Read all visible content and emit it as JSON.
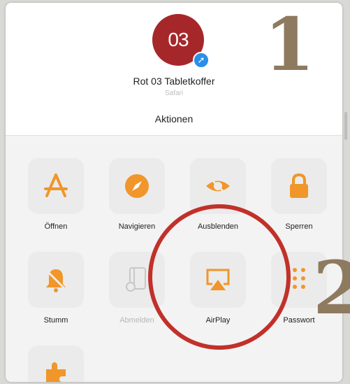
{
  "header": {
    "avatar_text": "03",
    "title": "Rot 03 Tabletkoffer",
    "subtitle": "Safari",
    "section_label": "Aktionen"
  },
  "annotations": {
    "marker_1": "1",
    "marker_2": "2"
  },
  "actions": [
    {
      "label": "Öffnen",
      "icon": "app-store-icon"
    },
    {
      "label": "Navigieren",
      "icon": "compass-icon"
    },
    {
      "label": "Ausblenden",
      "icon": "eye-slash-icon"
    },
    {
      "label": "Sperren",
      "icon": "lock-icon"
    },
    {
      "label": "Stumm",
      "icon": "bell-slash-icon"
    },
    {
      "label": "Abmelden",
      "icon": "device-icon"
    },
    {
      "label": "AirPlay",
      "icon": "airplay-icon"
    },
    {
      "label": "Passwort",
      "icon": "dots-icon"
    },
    {
      "label": "",
      "icon": "puzzle-icon"
    }
  ],
  "colors": {
    "accent": "#f0962a",
    "avatar": "#a6272a",
    "circle": "#c2302a",
    "number": "#8e7a5f"
  }
}
